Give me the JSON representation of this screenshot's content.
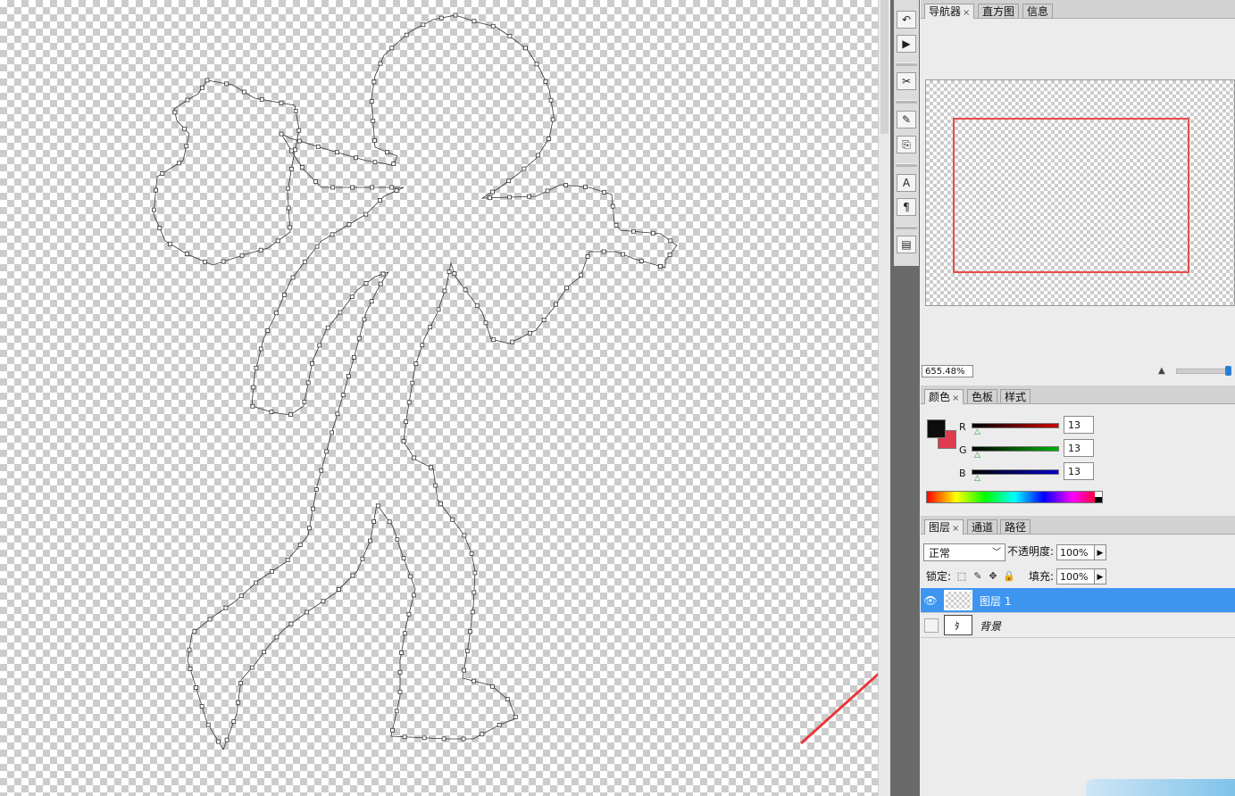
{
  "navigator_panel": {
    "tabs": [
      {
        "label": "导航器",
        "close": "×"
      },
      {
        "label": "直方图"
      },
      {
        "label": "信息"
      }
    ],
    "zoom_value": "655.48%"
  },
  "color_panel": {
    "tabs": [
      {
        "label": "颜色",
        "close": "×"
      },
      {
        "label": "色板"
      },
      {
        "label": "样式"
      }
    ],
    "foreground_color": "#0d0d0d",
    "background_color": "#e03a4f",
    "channels": [
      {
        "label": "R",
        "value": "13",
        "color": "#cc0000"
      },
      {
        "label": "G",
        "value": "13",
        "color": "#00b400"
      },
      {
        "label": "B",
        "value": "13",
        "color": "#0000cc"
      }
    ]
  },
  "layers_panel": {
    "tabs": [
      {
        "label": "图层",
        "close": "×"
      },
      {
        "label": "通道"
      },
      {
        "label": "路径"
      }
    ],
    "blend_mode": "正常",
    "opacity_label": "不透明度:",
    "opacity_value": "100%",
    "lock_label": "锁定:",
    "fill_label": "填充:",
    "fill_value": "100%",
    "layers": [
      {
        "name": "图层 1",
        "selected": true,
        "visible": true
      },
      {
        "name": "背景",
        "selected": false,
        "visible": false
      }
    ]
  },
  "annotation": {
    "arrow_color": "#e8383d"
  }
}
